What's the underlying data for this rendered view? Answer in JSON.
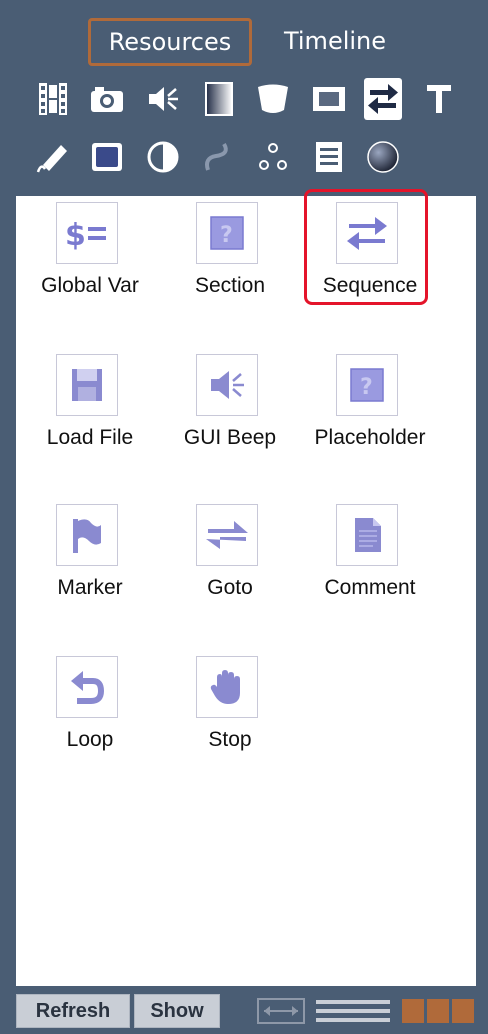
{
  "tabs": [
    {
      "label": "Resources",
      "active": true
    },
    {
      "label": "Timeline",
      "active": false
    }
  ],
  "toolbar": {
    "row1": [
      "film-icon",
      "camera-icon",
      "speaker-icon",
      "gradient-icon",
      "shield-icon",
      "frame-icon",
      "sequence-arrows-icon",
      "text-t-icon"
    ],
    "row2": [
      "pen-icon",
      "rectangle-icon",
      "half-circle-icon",
      "curve-icon",
      "dots-icon",
      "list-icon",
      "sphere-icon"
    ],
    "selected": "sequence-arrows-icon"
  },
  "items": [
    {
      "label": "Global Var",
      "icon": "global-var-icon"
    },
    {
      "label": "Section",
      "icon": "section-icon"
    },
    {
      "label": "Sequence",
      "icon": "sequence-icon",
      "highlighted": true
    },
    {
      "label": "Load File",
      "icon": "floppy-icon"
    },
    {
      "label": "GUI Beep",
      "icon": "beep-icon"
    },
    {
      "label": "Placeholder",
      "icon": "placeholder-icon"
    },
    {
      "label": "Marker",
      "icon": "flag-icon"
    },
    {
      "label": "Goto",
      "icon": "goto-icon"
    },
    {
      "label": "Comment",
      "icon": "document-icon"
    },
    {
      "label": "Loop",
      "icon": "loop-icon"
    },
    {
      "label": "Stop",
      "icon": "hand-icon"
    }
  ],
  "bottom": {
    "refresh_label": "Refresh",
    "show_label": "Show",
    "icons": [
      "fit-width-icon",
      "list-view-icon",
      "grid-view-icon"
    ]
  },
  "colors": {
    "background": "#4a5d74",
    "panel": "#ffffff",
    "active_tab_border": "#b06a3a",
    "highlight": "#e4142a",
    "icon_accent": "#8a8ad8"
  }
}
